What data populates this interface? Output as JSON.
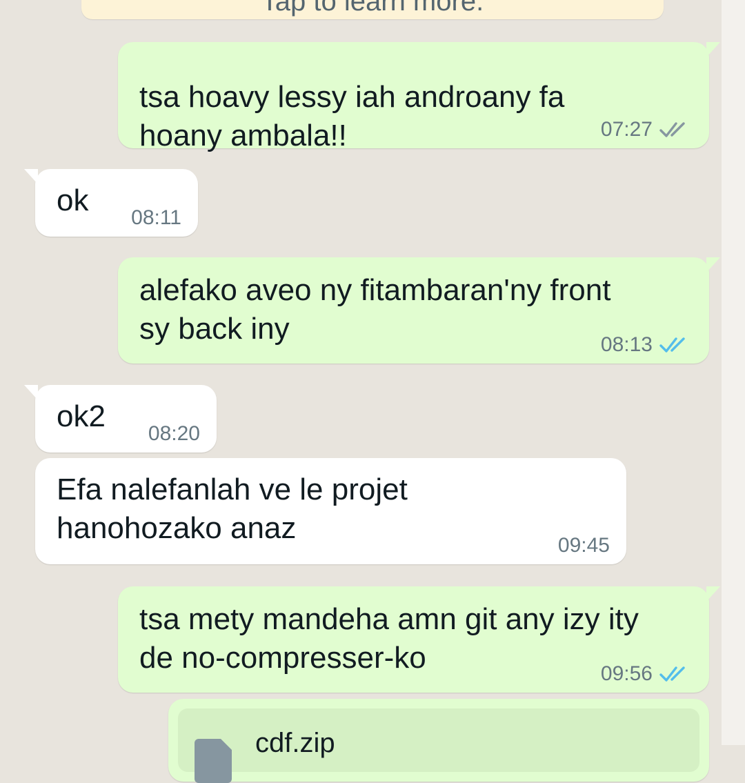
{
  "chat": {
    "notice_text": "Tap to learn more.",
    "messages": [
      {
        "direction": "outgoing",
        "lines": [
          "tsa hoavy lessy iah androany fa",
          "hoany ambala!!"
        ],
        "time": "07:27",
        "status": "delivered",
        "status_color": "#8696a0"
      },
      {
        "direction": "incoming",
        "lines": [
          "ok"
        ],
        "time": "08:11"
      },
      {
        "direction": "outgoing",
        "lines": [
          "alefako aveo ny fitambaran'ny front",
          "sy back iny"
        ],
        "time": "08:13",
        "status": "read",
        "status_color": "#53bdeb"
      },
      {
        "direction": "incoming",
        "lines": [
          "ok2"
        ],
        "time": "08:20"
      },
      {
        "direction": "incoming",
        "lines": [
          "Efa nalefanlah ve le projet",
          "hanohozako anaz"
        ],
        "time": "09:45"
      },
      {
        "direction": "outgoing",
        "lines": [
          "tsa mety mandeha amn git any izy ity",
          "de no-compresser-ko"
        ],
        "time": "09:56",
        "status": "read",
        "status_color": "#53bdeb"
      }
    ],
    "attachment": {
      "file_name": "cdf.zip",
      "icon": "document-icon"
    }
  },
  "colors": {
    "chat_background": "#e8e4dd",
    "outgoing_bubble": "#e1fdd0",
    "incoming_bubble": "#ffffff",
    "read_ticks": "#53bdeb",
    "delivered_ticks": "#8696a0"
  }
}
